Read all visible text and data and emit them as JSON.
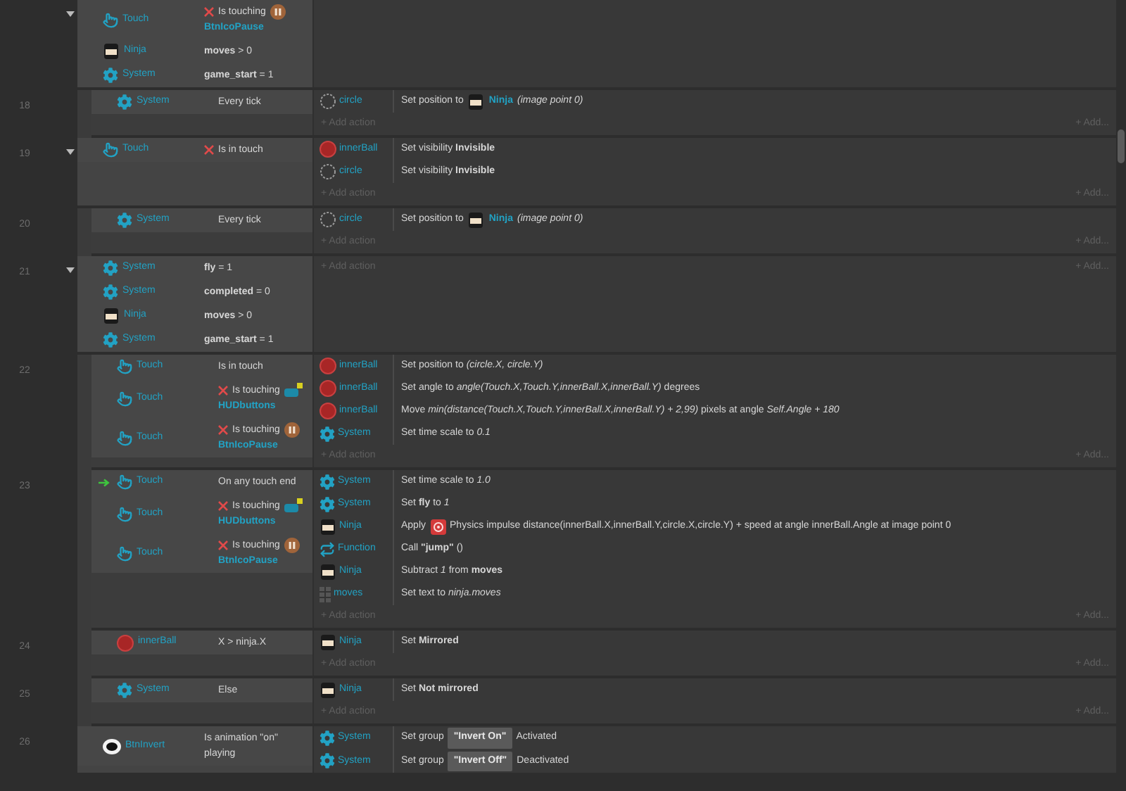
{
  "events": [
    {
      "kind": "event",
      "expanded": true,
      "conditions": [
        {
          "object": "Touch",
          "kind": "touch",
          "inverted": true,
          "trigger": false,
          "text": "Is touching",
          "target": {
            "kind": "pause-ball",
            "name": "BtnIcoPause"
          }
        },
        {
          "object": "Ninja",
          "kind": "ninja",
          "inverted": false,
          "trigger": false,
          "text": "**moves** > 0"
        },
        {
          "object": "System",
          "kind": "gear",
          "inverted": false,
          "trigger": false,
          "text": "**game_start** = 1"
        }
      ]
    },
    {
      "kind": "sub-event",
      "number": "18",
      "conditions": [
        {
          "object": "System",
          "kind": "gear",
          "inverted": false,
          "trigger": false,
          "text": "Every tick"
        }
      ],
      "actions": [
        {
          "object": "circle",
          "kind": "dotted-circle",
          "parts": [
            {
              "kind": "text",
              "text": "Set position to"
            },
            {
              "kind": "ninja-ref",
              "text": "Ninja"
            },
            {
              "kind": "text",
              "text": "*(image point 0)*"
            }
          ]
        }
      ],
      "add_label": "+ Add action",
      "add_more": "+ Add..."
    },
    {
      "kind": "event",
      "number": "19",
      "expanded": true,
      "conditions": [
        {
          "object": "Touch",
          "kind": "touch",
          "inverted": true,
          "trigger": false,
          "text": "Is in touch"
        }
      ],
      "actions": [
        {
          "object": "innerBall",
          "kind": "red-ball",
          "text": "Set visibility **Invisible**"
        },
        {
          "object": "circle",
          "kind": "dotted-circle",
          "text": "Set visibility **Invisible**"
        }
      ],
      "add_label": "+ Add action",
      "add_more": "+ Add..."
    },
    {
      "kind": "sub-event",
      "number": "20",
      "conditions": [
        {
          "object": "System",
          "kind": "gear",
          "inverted": false,
          "trigger": false,
          "text": "Every tick"
        }
      ],
      "actions": [
        {
          "object": "circle",
          "kind": "dotted-circle",
          "parts": [
            {
              "kind": "text",
              "text": "Set position to"
            },
            {
              "kind": "ninja-ref",
              "text": "Ninja"
            },
            {
              "kind": "text",
              "text": "*(image point 0)*"
            }
          ]
        }
      ],
      "add_label": "+ Add action",
      "add_more": "+ Add..."
    },
    {
      "kind": "event",
      "number": "21",
      "expanded": true,
      "conditions": [
        {
          "object": "System",
          "kind": "gear",
          "inverted": false,
          "trigger": false,
          "text": "**fly** = 1"
        },
        {
          "object": "System",
          "kind": "gear",
          "inverted": false,
          "trigger": false,
          "text": "**completed** = 0"
        },
        {
          "object": "Ninja",
          "kind": "ninja",
          "inverted": false,
          "trigger": false,
          "text": "**moves** > 0"
        },
        {
          "object": "System",
          "kind": "gear",
          "inverted": false,
          "trigger": false,
          "text": "**game_start** = 1"
        }
      ],
      "add_label": "+ Add action",
      "add_more": "+ Add..."
    },
    {
      "kind": "sub-event",
      "number": "22",
      "conditions": [
        {
          "object": "Touch",
          "kind": "touch",
          "inverted": false,
          "trigger": false,
          "text": "Is in touch"
        },
        {
          "object": "Touch",
          "kind": "touch",
          "inverted": true,
          "trigger": false,
          "text": "Is touching",
          "target": {
            "kind": "invader",
            "name": "HUDbuttons"
          }
        },
        {
          "object": "Touch",
          "kind": "touch",
          "inverted": true,
          "trigger": false,
          "text": "Is touching",
          "target": {
            "kind": "pause-ball",
            "name": "BtnIcoPause"
          }
        }
      ],
      "actions": [
        {
          "object": "innerBall",
          "kind": "red-ball",
          "text": "Set position to *(circle.X, circle.Y)*"
        },
        {
          "object": "innerBall",
          "kind": "red-ball",
          "text": "Set angle to *angle(Touch.X,Touch.Y,innerBall.X,innerBall.Y)* degrees"
        },
        {
          "object": "innerBall",
          "kind": "red-ball",
          "text": "Move *min(distance(Touch.X,Touch.Y,innerBall.X,innerBall.Y) + 2,99)* pixels at angle *Self.Angle + 180*"
        },
        {
          "object": "System",
          "kind": "gear",
          "text": "Set time scale to *0.1*"
        }
      ],
      "add_label": "+ Add action",
      "add_more": "+ Add..."
    },
    {
      "kind": "sub-event",
      "number": "23",
      "conditions": [
        {
          "object": "Touch",
          "kind": "touch",
          "inverted": false,
          "trigger": true,
          "text": "On any touch end"
        },
        {
          "object": "Touch",
          "kind": "touch",
          "inverted": true,
          "trigger": false,
          "text": "Is touching",
          "target": {
            "kind": "invader",
            "name": "HUDbuttons"
          }
        },
        {
          "object": "Touch",
          "kind": "touch",
          "inverted": true,
          "trigger": false,
          "text": "Is touching",
          "target": {
            "kind": "pause-ball",
            "name": "BtnIcoPause"
          }
        }
      ],
      "actions": [
        {
          "object": "System",
          "kind": "gear",
          "text": "Set time scale to *1.0*"
        },
        {
          "object": "System",
          "kind": "gear",
          "text": "Set **fly** to *1*"
        },
        {
          "object": "Ninja",
          "kind": "ninja",
          "parts": [
            {
              "kind": "text",
              "text": "Apply"
            },
            {
              "kind": "atom"
            },
            {
              "kind": "text",
              "text": "Physics impulse distance(innerBall.X,innerBall.Y,circle.X,circle.Y) + speed at angle innerBall.Angle at image point 0"
            }
          ]
        },
        {
          "object": "Function",
          "kind": "loop",
          "text": "Call **\"jump\"** ()"
        },
        {
          "object": "Ninja",
          "kind": "ninja",
          "text": "Subtract *1* from **moves**"
        },
        {
          "object": "moves",
          "kind": "grid",
          "text": "Set text to *ninja.moves*"
        }
      ],
      "add_label": "+ Add action",
      "add_more": "+ Add..."
    },
    {
      "kind": "sub-event",
      "number": "24",
      "conditions": [
        {
          "object": "innerBall",
          "kind": "red-ball",
          "inverted": false,
          "trigger": false,
          "text": "X > ninja.X"
        }
      ],
      "actions": [
        {
          "object": "Ninja",
          "kind": "ninja",
          "text": "Set **Mirrored**"
        }
      ],
      "add_label": "+ Add action",
      "add_more": "+ Add..."
    },
    {
      "kind": "sub-event",
      "number": "25",
      "conditions": [
        {
          "object": "System",
          "kind": "gear",
          "inverted": false,
          "trigger": false,
          "text": "Else"
        }
      ],
      "actions": [
        {
          "object": "Ninja",
          "kind": "ninja",
          "text": "Set **Not mirrored**"
        }
      ],
      "add_label": "+ Add action",
      "add_more": "+ Add..."
    },
    {
      "kind": "event",
      "number": "26",
      "conditions": [
        {
          "object": "BtnInvert",
          "kind": "bw-ball",
          "inverted": false,
          "trigger": false,
          "text": "Is animation \"on\" playing"
        }
      ],
      "actions": [
        {
          "object": "System",
          "kind": "gear",
          "parts": [
            {
              "kind": "text",
              "text": "Set group"
            },
            {
              "kind": "pill",
              "text": "\"Invert On\""
            },
            {
              "kind": "text",
              "text": "Activated"
            }
          ]
        },
        {
          "object": "System",
          "kind": "gear",
          "parts": [
            {
              "kind": "text",
              "text": "Set group"
            },
            {
              "kind": "pill",
              "text": "\"Invert Off\""
            },
            {
              "kind": "text",
              "text": "Deactivated"
            }
          ]
        }
      ]
    }
  ]
}
